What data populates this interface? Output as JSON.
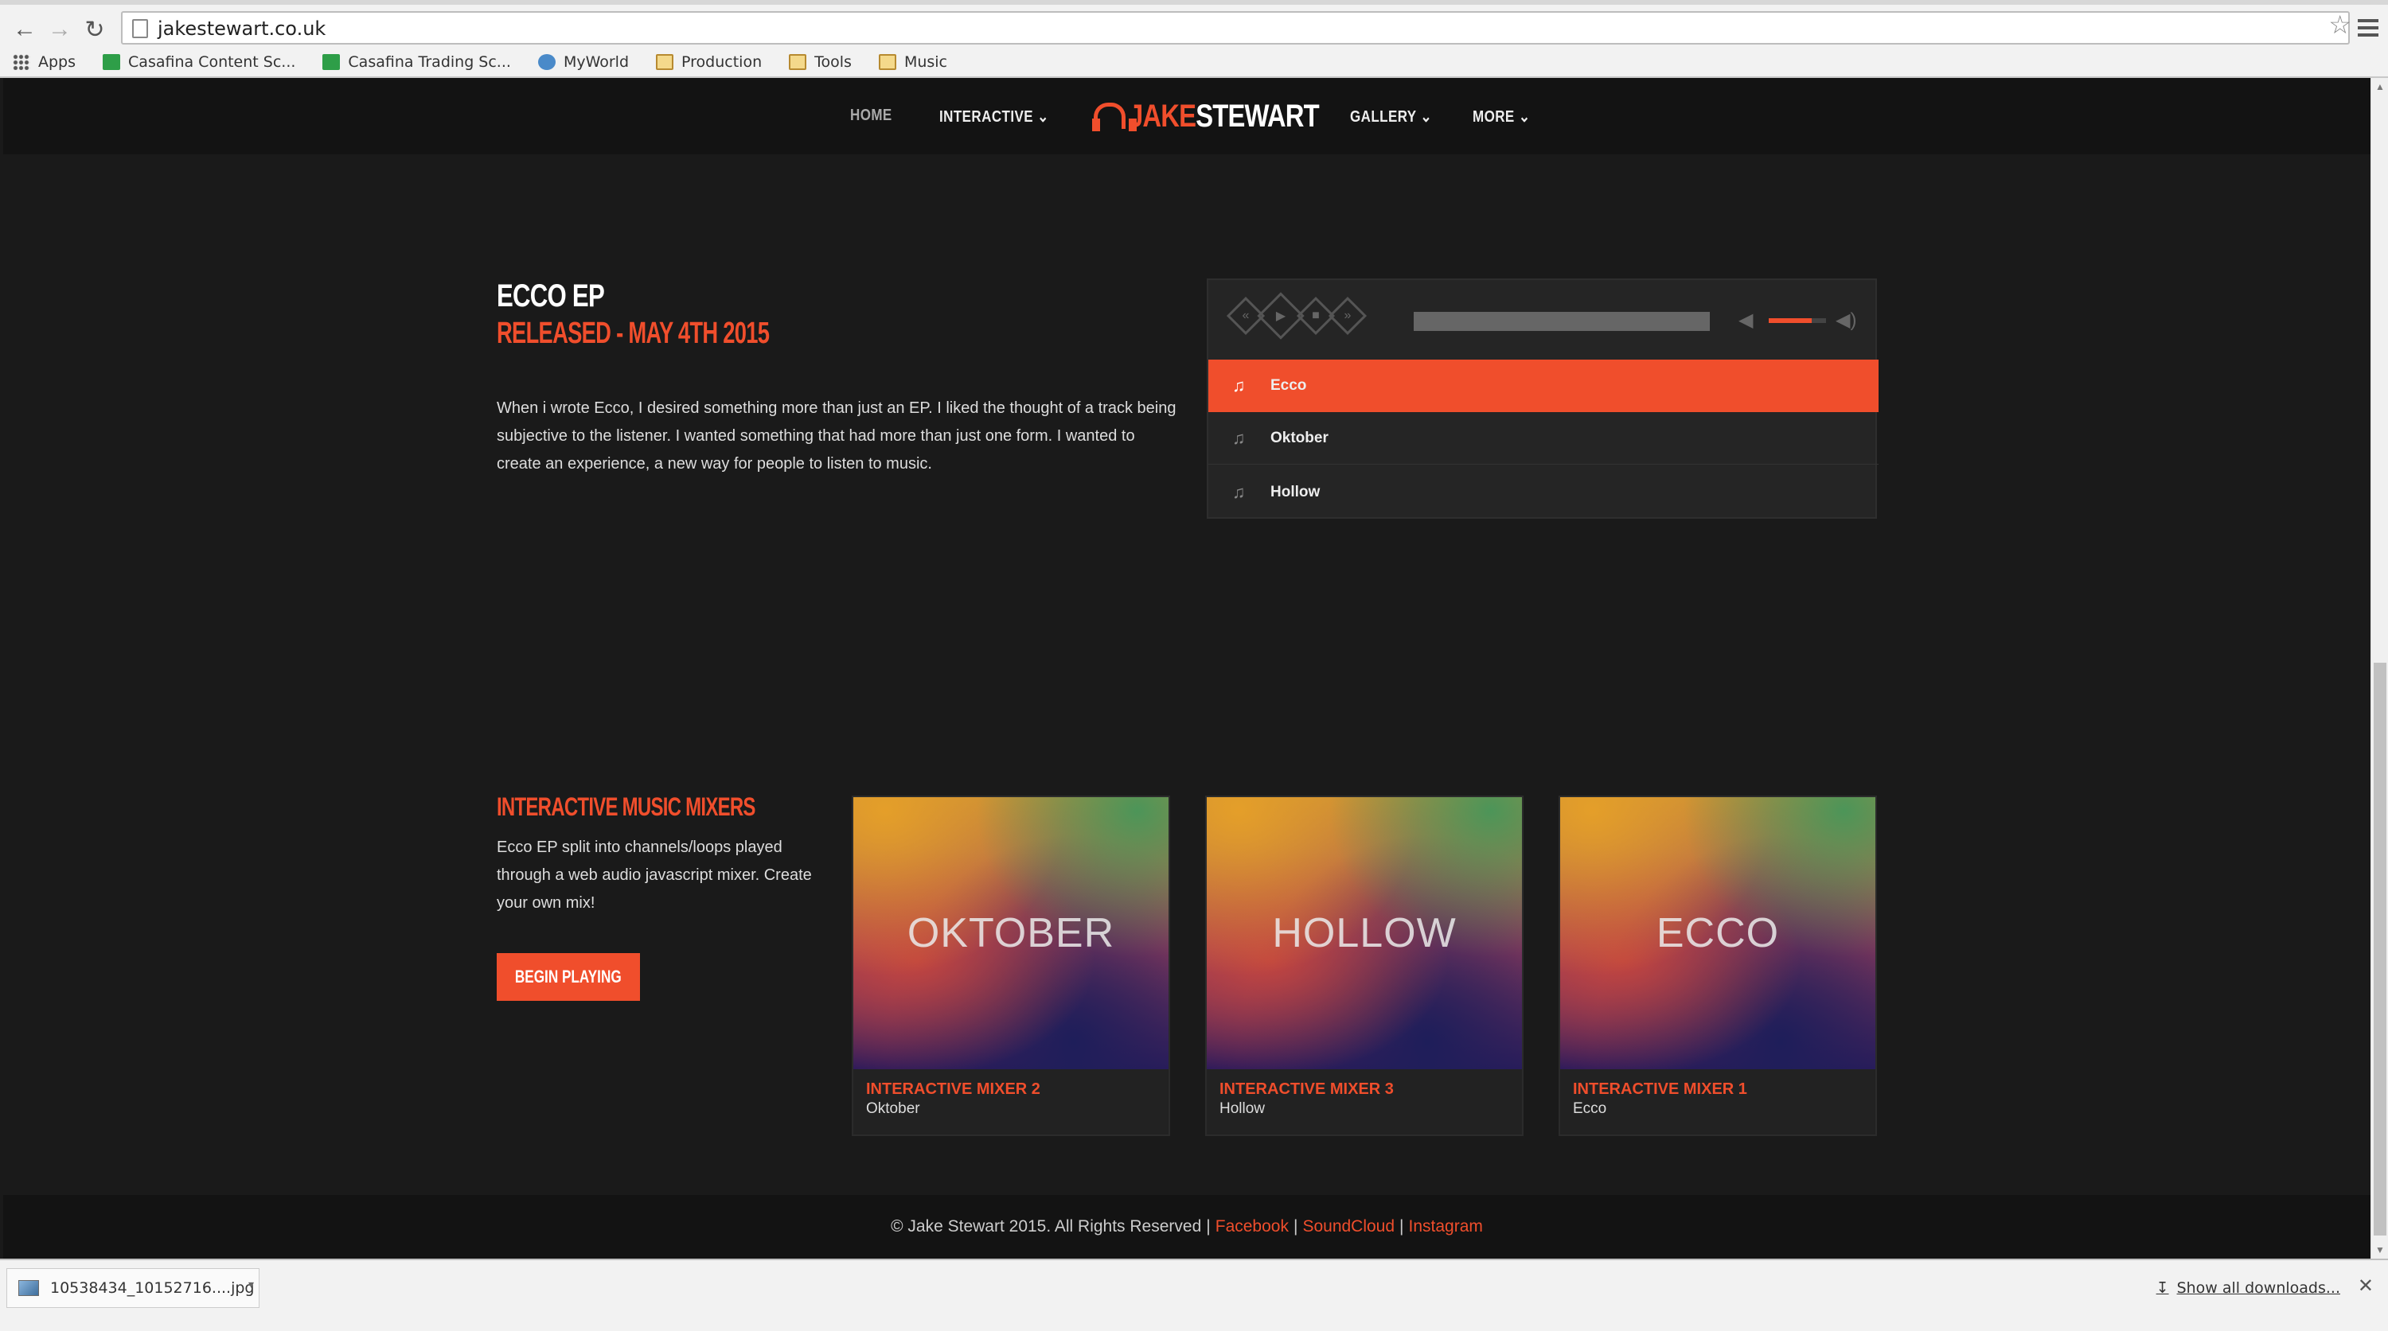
{
  "browser": {
    "url": "jakestewart.co.uk",
    "bookmarks": [
      {
        "label": "Apps",
        "icon": "apps-grid-icon"
      },
      {
        "label": "Casafina Content Sc...",
        "icon": "sheets-icon"
      },
      {
        "label": "Casafina Trading Sc...",
        "icon": "sheets-icon"
      },
      {
        "label": "MyWorld",
        "icon": "world-icon"
      },
      {
        "label": "Production",
        "icon": "folder-icon"
      },
      {
        "label": "Tools",
        "icon": "folder-icon"
      },
      {
        "label": "Music",
        "icon": "folder-icon"
      }
    ]
  },
  "nav": {
    "home": "HOME",
    "interactive": "INTERACTIVE",
    "logo_a": "JAKE",
    "logo_b": "STEWART",
    "gallery": "GALLERY",
    "more": "MORE"
  },
  "ep": {
    "title": "ECCO EP",
    "subtitle": "RELEASED - MAY 4TH 2015",
    "body": "When i wrote Ecco, I desired something more than just an EP. I liked the thought of a track being subjective to the listener. I wanted something that had more than just one form. I wanted to create an experience, a new way for people to listen to music."
  },
  "player": {
    "tracks": [
      "Ecco",
      "Oktober",
      "Hollow"
    ],
    "active_track_index": 0,
    "volume_level": 0.75
  },
  "mixers": {
    "title": "INTERACTIVE MUSIC MIXERS",
    "body": "Ecco EP split into channels/loops played through a web audio javascript mixer. Create your own mix!",
    "button": "BEGIN PLAYING",
    "cards": [
      {
        "art_label": "OKTOBER",
        "title": "INTERACTIVE MIXER 2",
        "subtitle": "Oktober"
      },
      {
        "art_label": "HOLLOW",
        "title": "INTERACTIVE MIXER 3",
        "subtitle": "Hollow"
      },
      {
        "art_label": "ECCO",
        "title": "INTERACTIVE MIXER 1",
        "subtitle": "Ecco"
      }
    ]
  },
  "footer": {
    "copyright": "© Jake Stewart 2015. All Rights Reserved",
    "links": [
      "Facebook",
      "SoundCloud",
      "Instagram"
    ]
  },
  "downloads": {
    "file": "10538434_10152716....jpg",
    "show_all": "Show all downloads..."
  },
  "colors": {
    "accent": "#f04e2c",
    "background": "#1a1a1a",
    "navbar": "#131313"
  }
}
